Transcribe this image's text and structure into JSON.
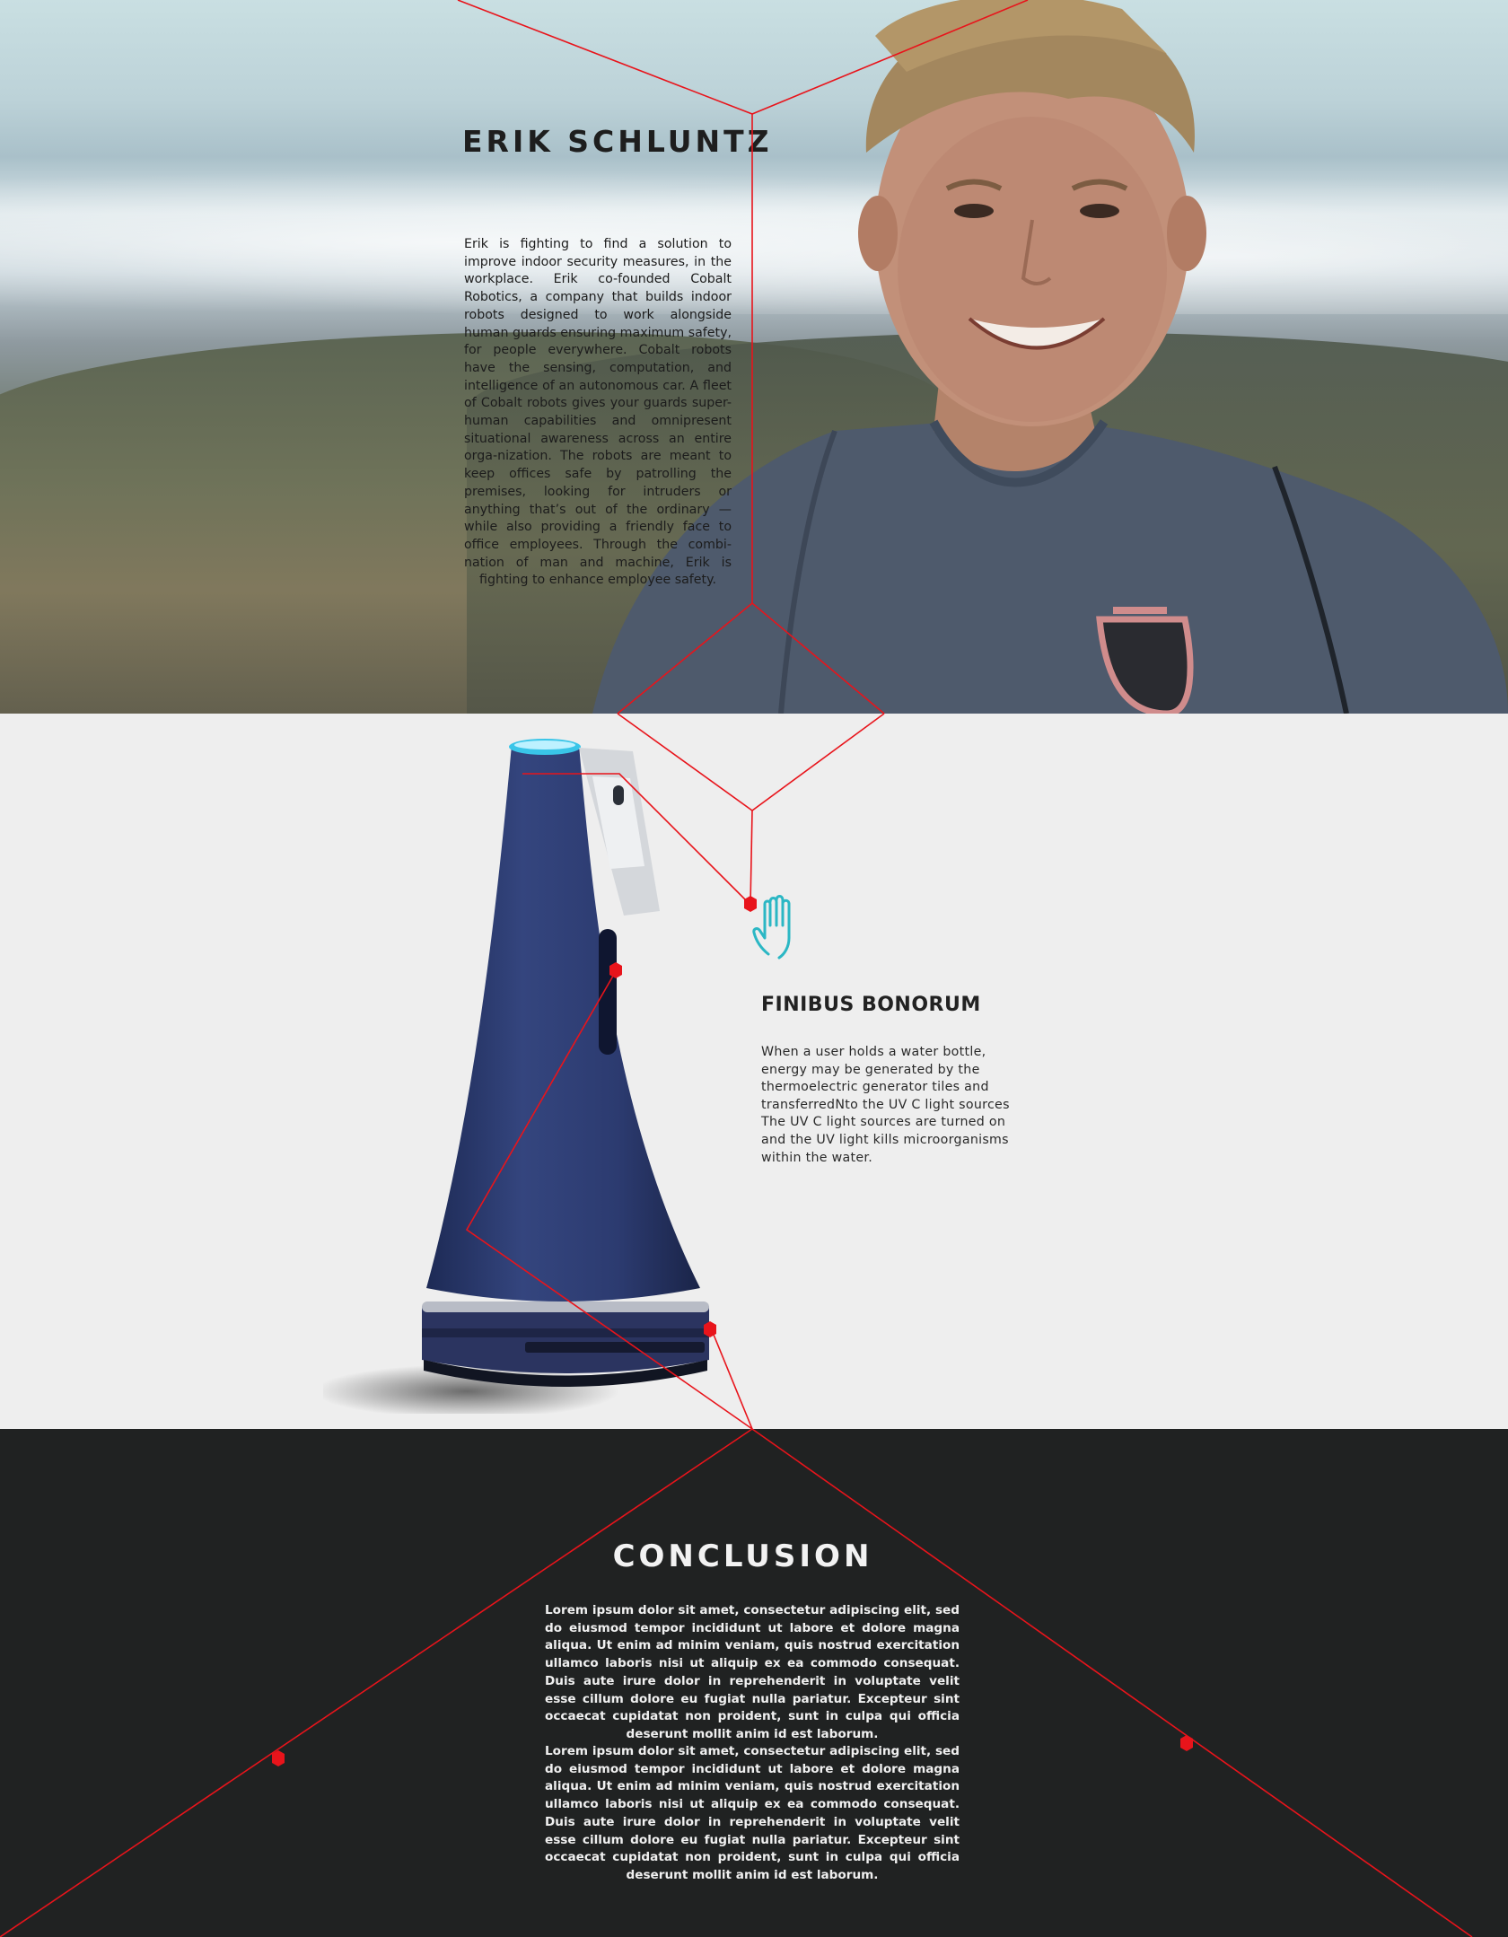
{
  "profile": {
    "name": "ERIK SCHLUNTZ",
    "bio": "Erik is fighting to find a solution to improve indoor security measures, in the workplace. Erik co-founded Cobalt Robotics, a company that builds indoor robots designed to work alongside human guards ensuring maximum safety, for people everywhere. Cobalt robots have the sensing, computation, and intelligence of an autonomous car. A fleet of Cobalt robots gives your guards super-human capabilities and omnipresent situational awareness across an entire orga-nization. The robots are meant to keep offices safe by patrolling the premises, looking for intruders or anything that’s out of the ordinary — while also providing a friendly face to office employees. Through the combi-nation of man and machine, Erik is fighting to enhance employee safety."
  },
  "feature": {
    "icon": "hand-icon",
    "title": "FINIBUS BONORUM",
    "text": "When a user holds a water bottle, energy may be generated by the thermoelectric generator tiles  and transferredNto the UV C light sources The UV C light sources  are turned on and the UV light  kills microorganisms within the water."
  },
  "conclusion": {
    "title": "CONCLUSION",
    "paragraphs": [
      "Lorem ipsum dolor sit amet, consectetur adipiscing elit, sed do eiusmod tempor incididunt ut labore et dolore magna aliqua. Ut enim ad minim veniam, quis nostrud exercitation ullamco laboris nisi ut aliquip ex ea commodo consequat. Duis aute irure dolor in reprehenderit in voluptate velit esse cillum dolore eu fugiat nulla pariatur. Excepteur sint occaecat cupidatat non proident, sunt in culpa qui officia deserunt mollit anim id est laborum.",
      "Lorem ipsum dolor sit amet, consectetur adipiscing elit, sed do eiusmod tempor incididunt ut labore et dolore magna aliqua. Ut enim ad minim veniam, quis nostrud exercitation ullamco laboris nisi ut aliquip ex ea commodo consequat. Duis aute irure dolor in reprehenderit in voluptate velit esse cillum dolore eu fugiat nulla pariatur. Excepteur sint occaecat cupidatat non proident, sunt in culpa qui officia deserunt mollit anim id est laborum."
    ]
  },
  "colors": {
    "accent_red": "#e8141b",
    "icon_teal": "#2bb7c4",
    "dark_section": "#202222",
    "light_section": "#eeeeee",
    "robot_body": "#2a3868"
  }
}
